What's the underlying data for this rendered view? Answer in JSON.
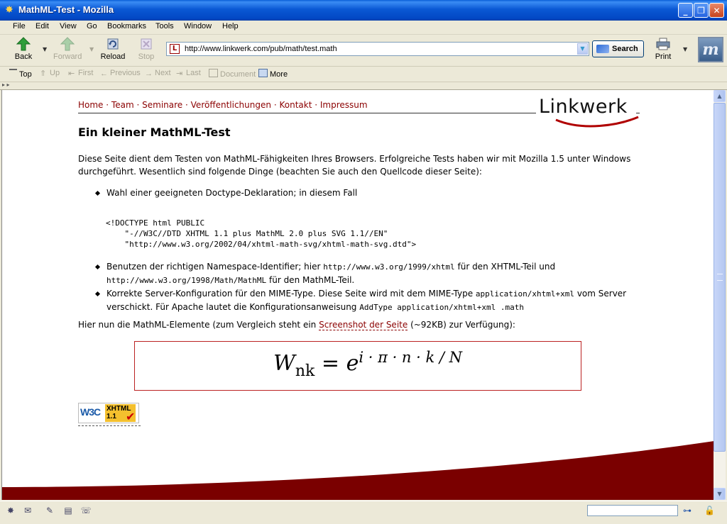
{
  "window": {
    "title": "MathML-Test - Mozilla",
    "app_icon": "mozilla-icon",
    "controls": [
      "minimize",
      "restore",
      "close"
    ]
  },
  "menu": {
    "items": [
      "File",
      "Edit",
      "View",
      "Go",
      "Bookmarks",
      "Tools",
      "Window",
      "Help"
    ]
  },
  "toolbar": {
    "back": "Back",
    "forward": "Forward",
    "reload": "Reload",
    "stop": "Stop",
    "url": "http://www.linkwerk.com/pub/math/test.math",
    "search": "Search",
    "print": "Print",
    "throbber": "m"
  },
  "sitebar": {
    "items": [
      "Top",
      "Up",
      "First",
      "Previous",
      "Next",
      "Last",
      "Document",
      "More"
    ],
    "enabled": [
      true,
      false,
      false,
      false,
      false,
      false,
      false,
      true
    ]
  },
  "page": {
    "nav": [
      "Home",
      "Team",
      "Seminare",
      "Veröffentlichungen",
      "Kontakt",
      "Impressum"
    ],
    "logo": "Linkwerk",
    "heading": "Ein kleiner MathML-Test",
    "intro": "Diese Seite dient dem Testen von MathML-Fähigkeiten Ihres Browsers. Erfolgreiche Tests haben wir mit Mozilla 1.5 unter Windows durchgeführt. Wesentlich sind folgende Dinge (beachten Sie auch den Quellcode dieser Seite):",
    "item1": "Wahl einer geeigneten Doctype-Deklaration; in diesem Fall",
    "doctype": "<!DOCTYPE html PUBLIC\n    \"-//W3C//DTD XHTML 1.1 plus MathML 2.0 plus SVG 1.1//EN\"\n    \"http://www.w3.org/2002/04/xhtml-math-svg/xhtml-math-svg.dtd\">",
    "item2_a": "Benutzen der richtigen Namespace-Identifier; hier ",
    "item2_ns1": "http://www.w3.org/1999/xhtml",
    "item2_b": " für den XHTML-Teil und ",
    "item2_ns2": "http://www.w3.org/1998/Math/MathML",
    "item2_c": " für den MathML-Teil.",
    "item3_a": "Korrekte Server-Konfiguration für den MIME-Type. Diese Seite wird mit dem MIME-Type ",
    "item3_mime": "application/xhtml+xml",
    "item3_b": " vom Server verschickt. Für Apache lautet die Konfigurationsanweisung ",
    "item3_cfg": "AddType application/xhtml+xml .math",
    "hier_a": "Hier nun die MathML-Elemente (zum Vergleich steht ein ",
    "hier_link": "Screenshot der Seite",
    "hier_b": " (~92KB) zur Verfügung):",
    "formula": {
      "base": "W",
      "sub": "nk",
      "eq": "=",
      "exp_base": "e",
      "exp": "i · π · n · k / N"
    },
    "badge": {
      "w3c": "W3C",
      "xhtml": "XHTML",
      "version": "1.1"
    }
  },
  "colors": {
    "accent": "#8b0000",
    "titlebar": "#0a58d4"
  },
  "status": {
    "icons": [
      "navigator-icon",
      "mail-icon",
      "composer-icon",
      "addressbook-icon",
      "chatzilla-icon"
    ]
  }
}
